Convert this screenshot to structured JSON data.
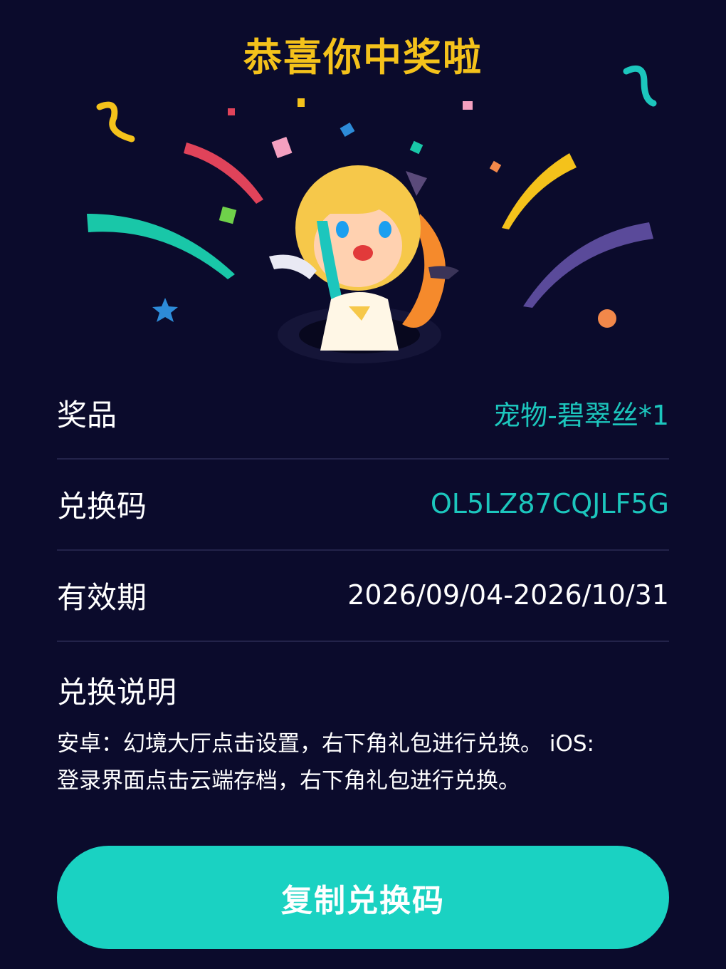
{
  "header": {
    "title": "恭喜你中奖啦"
  },
  "prize": {
    "rows": [
      {
        "label": "奖品",
        "value": "宠物-碧翠丝*1"
      },
      {
        "label": "兑换码",
        "value": "OL5LZ87CQJLF5G"
      },
      {
        "label": "有效期",
        "value": "2026/09/04-2026/10/31"
      }
    ]
  },
  "instructions": {
    "title": "兑换说明",
    "line1": "安卓：幻境大厅点击设置，右下角礼包进行兑换。 iOS:",
    "line2": "登录界面点击云端存档，右下角礼包进行兑换。"
  },
  "actions": {
    "copy_button": "复制兑换码"
  },
  "colors": {
    "accent": "#1cc6bd",
    "title": "#f4c21b",
    "background": "#0b0b2c",
    "button": "#1ad2c2"
  }
}
